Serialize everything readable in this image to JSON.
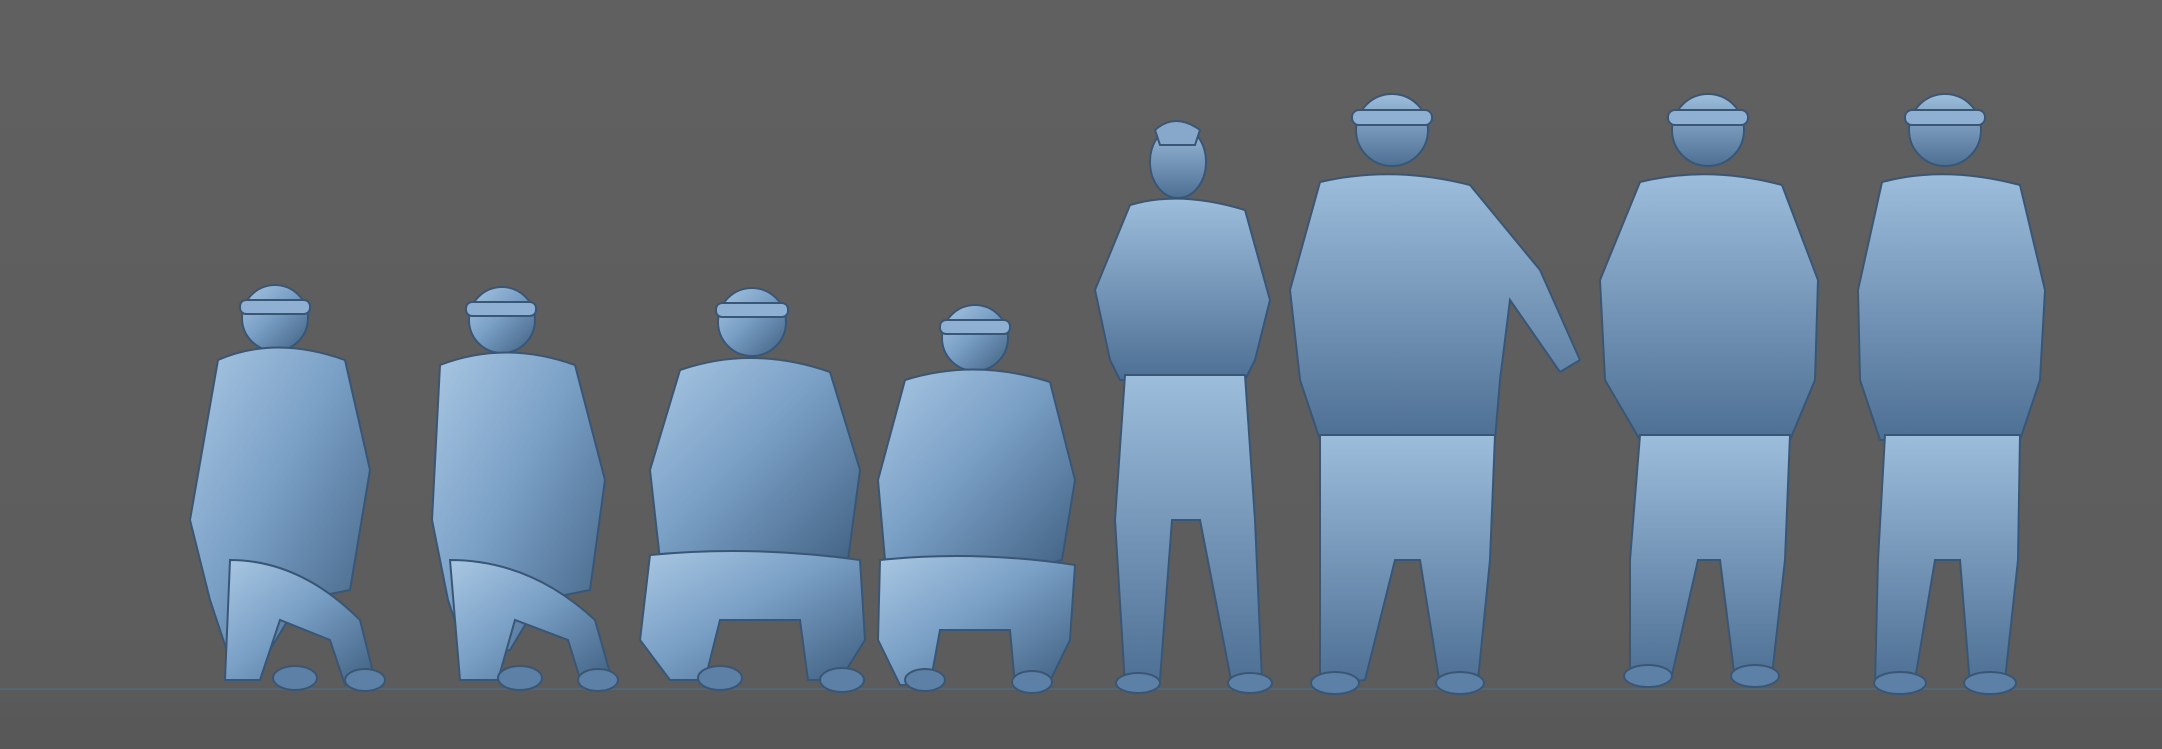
{
  "scene": {
    "background_color": "#5f5f5f",
    "figure_color": "#6f95bd",
    "figure_highlight": "#a9c7e3",
    "figure_shadow": "#3f5f80",
    "figures": [
      {
        "id": "kneeling-pilot-1",
        "pose": "kneeling"
      },
      {
        "id": "kneeling-pilot-2",
        "pose": "kneeling"
      },
      {
        "id": "crouching-pilot-3",
        "pose": "crouching"
      },
      {
        "id": "crouching-pilot-4",
        "pose": "crouching"
      },
      {
        "id": "standing-officer-5",
        "pose": "standing"
      },
      {
        "id": "standing-pilot-6",
        "pose": "standing"
      },
      {
        "id": "standing-pilot-7",
        "pose": "standing"
      },
      {
        "id": "standing-pilot-8",
        "pose": "standing"
      }
    ]
  }
}
